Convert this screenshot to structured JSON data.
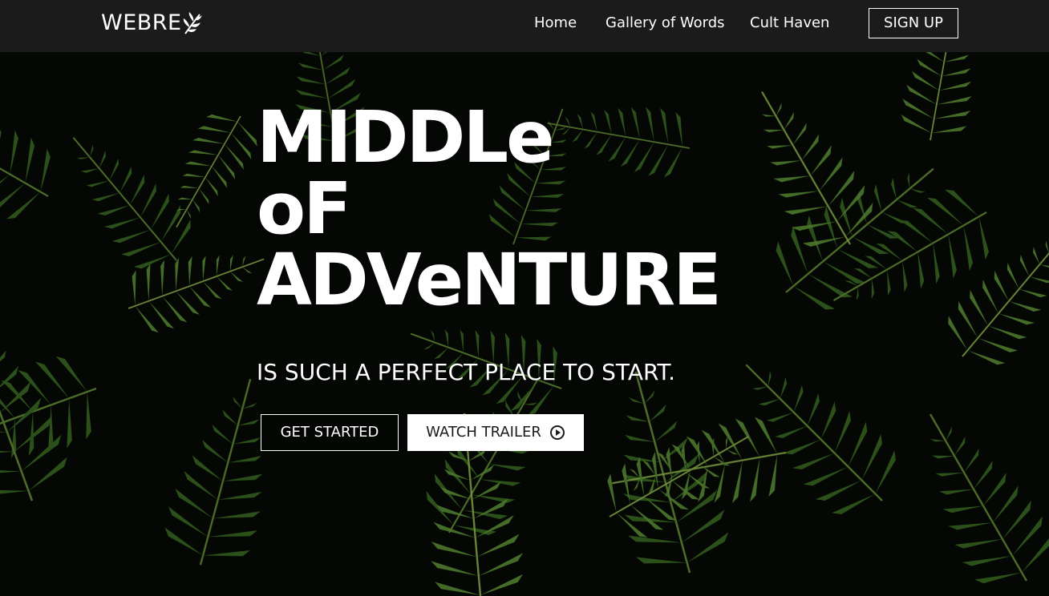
{
  "navbar": {
    "logo_text": "WEBRE",
    "logo_icon": "leaf-sprig-icon",
    "links": [
      {
        "label": "Home"
      },
      {
        "label": "Gallery of Words"
      },
      {
        "label": "Cult Haven"
      }
    ],
    "signup_label": "SIGN UP"
  },
  "hero": {
    "headline_lines": [
      "MIDDLe",
      "oF",
      "ADVeNTURE"
    ],
    "subheadline": "IS SUCH A PERFECT PLACE TO START.",
    "primary_button": "GET STARTED",
    "secondary_button": "WATCH TRAILER",
    "secondary_icon": "play-circle-icon",
    "background": "fern-leaves-photo"
  },
  "colors": {
    "navbar_bg": "#1b1b1b",
    "text": "#ffffff",
    "fern_green": "#4f7d2a"
  }
}
